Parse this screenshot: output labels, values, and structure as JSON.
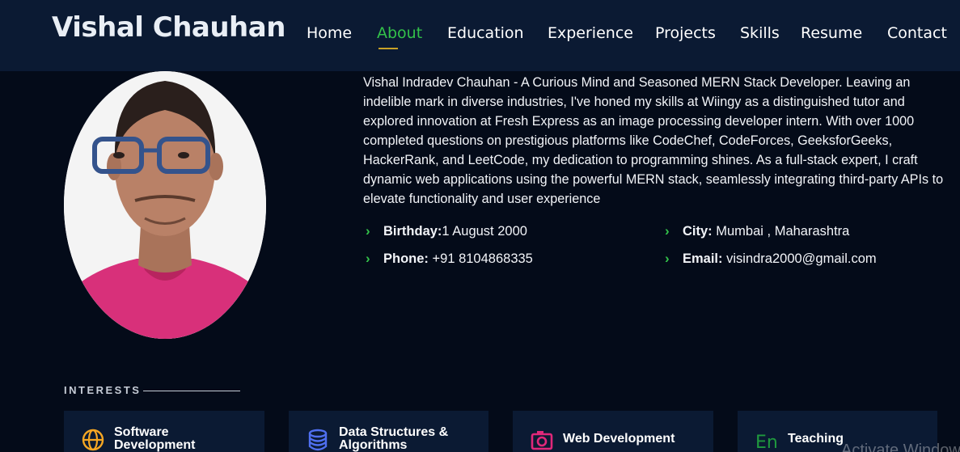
{
  "brand": "Vishal Chauhan",
  "nav": {
    "home": "Home",
    "about": "About",
    "education": "Education",
    "experience": "Experience",
    "projects": "Projects",
    "skills": "Skills",
    "resume": "Resume",
    "contact": "Contact",
    "active": "About"
  },
  "about": {
    "bio": "Vishal Indradev Chauhan - A Curious Mind and Seasoned MERN Stack Developer. Leaving an indelible mark in diverse industries, I've honed my skills at Wiingy as a distinguished tutor and explored innovation at Fresh Express as an image processing developer intern. With over 1000 completed questions on prestigious platforms like CodeChef, CodeForces, GeeksforGeeks, HackerRank, and LeetCode, my dedication to programming shines. As a full-stack expert, I craft dynamic web applications using the powerful MERN stack, seamlessly integrating third-party APIs to elevate functionality and user experience",
    "info": {
      "birthday_label": "Birthday:",
      "birthday_value": "1 August 2000",
      "city_label": "City:",
      "city_value": " Mumbai , Maharashtra",
      "phone_label": "Phone:",
      "phone_value": " +91 8104868335",
      "email_label": "Email:",
      "email_value": " visindra2000@gmail.com"
    }
  },
  "interests": {
    "title": "INTERESTS",
    "items": [
      {
        "label": "Software Development",
        "icon": "globe-icon",
        "color": "#f5a623"
      },
      {
        "label": "Data Structures & Algorithms",
        "icon": "database-icon",
        "color": "#4f6ff0"
      },
      {
        "label": "Web Development",
        "icon": "camera-icon",
        "color": "#e0287a"
      },
      {
        "label": "Teaching",
        "icon": "language-icon",
        "color": "#1f9a3e"
      }
    ]
  },
  "watermark": "Activate Windows",
  "colors": {
    "background": "#040b19",
    "navbar": "#0b1a33",
    "accent_green": "#33c24a",
    "nav_underline": "#c9a227"
  }
}
